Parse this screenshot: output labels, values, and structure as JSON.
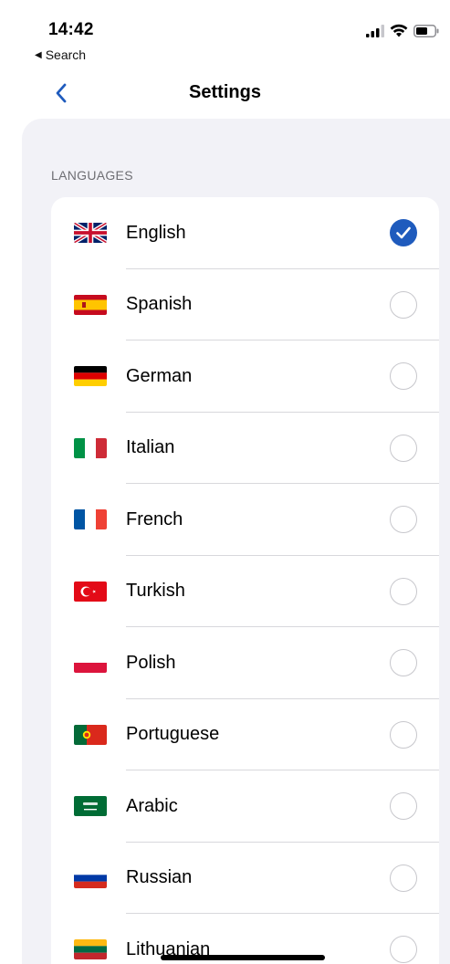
{
  "status_bar": {
    "time": "14:42",
    "back_app_label": "Search",
    "icons": [
      "cellular-signal-icon",
      "wifi-icon",
      "battery-icon"
    ]
  },
  "nav": {
    "title": "Settings",
    "back_icon": "chevron-left-icon"
  },
  "section": {
    "header": "LANGUAGES"
  },
  "languages": [
    {
      "label": "English",
      "flag": "uk-flag-icon",
      "selected": true
    },
    {
      "label": "Spanish",
      "flag": "spain-flag-icon",
      "selected": false
    },
    {
      "label": "German",
      "flag": "germany-flag-icon",
      "selected": false
    },
    {
      "label": "Italian",
      "flag": "italy-flag-icon",
      "selected": false
    },
    {
      "label": "French",
      "flag": "france-flag-icon",
      "selected": false
    },
    {
      "label": "Turkish",
      "flag": "turkey-flag-icon",
      "selected": false
    },
    {
      "label": "Polish",
      "flag": "poland-flag-icon",
      "selected": false
    },
    {
      "label": "Portuguese",
      "flag": "portugal-flag-icon",
      "selected": false
    },
    {
      "label": "Arabic",
      "flag": "saudi-arabia-flag-icon",
      "selected": false
    },
    {
      "label": "Russian",
      "flag": "russia-flag-icon",
      "selected": false
    },
    {
      "label": "Lithuanian",
      "flag": "lithuania-flag-icon",
      "selected": false
    }
  ],
  "colors": {
    "accent": "#1f5bbd",
    "background_panel": "#f2f2f7",
    "section_header": "#6e6e73"
  }
}
